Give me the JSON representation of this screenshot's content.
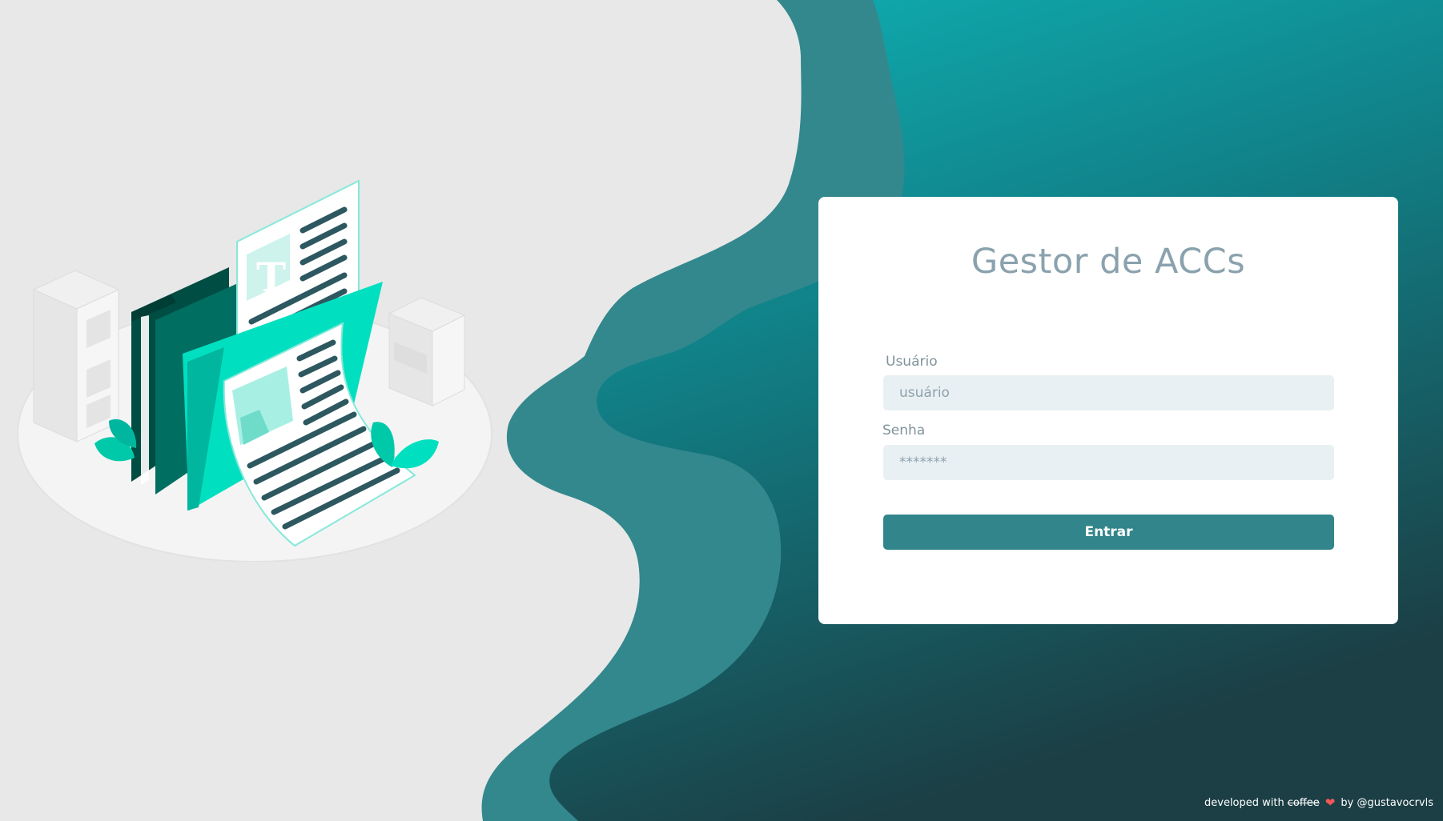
{
  "login": {
    "title": "Gestor de ACCs",
    "username_label": "Usuário",
    "username_placeholder": "usuário",
    "password_label": "Senha",
    "password_placeholder": "*******",
    "submit_label": "Entrar"
  },
  "footer": {
    "prefix": "developed with",
    "struck_word": "coffee",
    "heart_icon": "heart-icon",
    "suffix": "by @gustavocrvls"
  },
  "colors": {
    "background_light": "#e8e8e8",
    "teal_dark": "#32858a",
    "teal_gradient_top": "#0eb3b6",
    "teal_gradient_bottom": "#1b3f45",
    "card": "#ffffff",
    "input_bg": "#e9f0f3",
    "title": "#8aa2ad",
    "heart": "#f0585a"
  }
}
